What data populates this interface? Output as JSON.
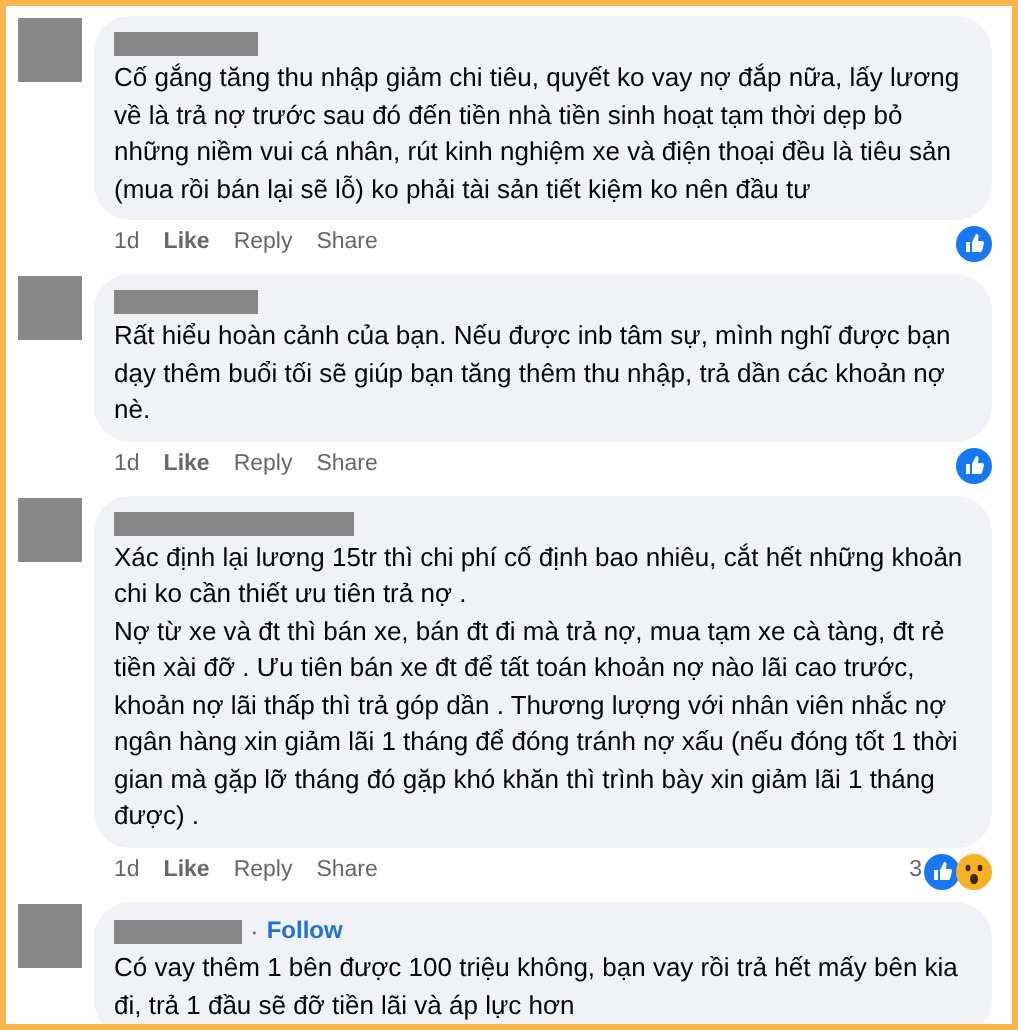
{
  "comments": [
    {
      "paragraphs": [
        "Cố gắng tăng thu nhập giảm chi tiêu, quyết ko vay nợ đắp nữa, lấy lương về là trả nợ trước sau đó đến tiền nhà tiền sinh hoạt tạm thời dẹp bỏ những niềm vui cá nhân, rút kinh nghiệm xe và điện thoại đều là tiêu sản (mua rồi bán lại sẽ lỗ) ko phải tài sản tiết kiệm ko nên đầu tư"
      ],
      "actions": [
        "1d",
        "Like",
        "Reply",
        "Share"
      ],
      "reactions": [
        {
          "kind": "like"
        }
      ]
    },
    {
      "paragraphs": [
        "Rất hiểu hoàn cảnh của bạn. Nếu được inb tâm sự, mình nghĩ được bạn dạy thêm buổi tối sẽ giúp bạn tăng thêm thu nhập, trả dần các khoản nợ nè."
      ],
      "actions": [
        "1d",
        "Like",
        "Reply",
        "Share"
      ],
      "reactions": [
        {
          "kind": "like"
        }
      ]
    },
    {
      "paragraphs": [
        "Xác định lại lương 15tr thì chi phí cố định bao nhiêu, cắt hết những khoản chi ko cần thiết ưu tiên trả nợ .",
        "Nợ từ xe và đt thì bán xe, bán đt đi mà trả nợ, mua tạm xe cà tàng, đt rẻ tiền xài đỡ . Ưu tiên bán xe đt để tất toán khoản nợ nào lãi cao trước, khoản nợ lãi thấp thì trả góp dần . Thương lượng với nhân viên nhắc nợ ngân hàng xin giảm lãi 1 tháng để đóng tránh nợ xấu (nếu đóng tốt 1 thời gian mà gặp lỡ tháng đó gặp khó khăn thì trình bày xin giảm lãi 1 tháng được) ."
      ],
      "actions": [
        "1d",
        "Like",
        "Reply",
        "Share"
      ],
      "reaction_count": "3",
      "reactions": [
        {
          "kind": "like"
        },
        {
          "kind": "wow"
        }
      ]
    },
    {
      "separator": "·",
      "follow": "Follow",
      "paragraphs": [
        "Có vay thêm 1 bên được 100 triệu không, bạn vay rồi trả hết mấy bên kia đi, trả 1 đầu sẽ đỡ tiền lãi và áp lực hơn"
      ]
    }
  ]
}
